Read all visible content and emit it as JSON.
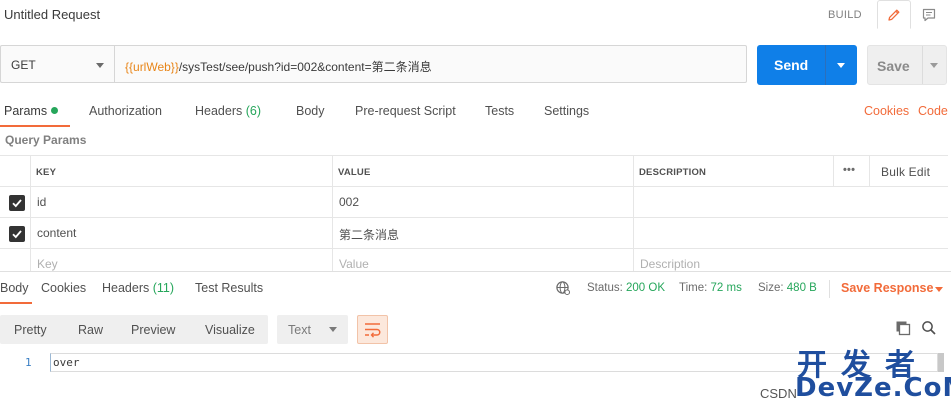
{
  "header": {
    "title": "Untitled Request",
    "build_label": "BUILD",
    "edit_icon": "pencil-icon",
    "comment_icon": "comment-icon"
  },
  "request": {
    "method": "GET",
    "url_variable": "{{urlWeb}}",
    "url_path": "/sysTest/see/push?id=002&content=第二条消息",
    "send_label": "Send",
    "save_label": "Save"
  },
  "request_tabs": {
    "params": "Params",
    "authorization": "Authorization",
    "headers": "Headers",
    "headers_count": "(6)",
    "body": "Body",
    "prerequest": "Pre-request Script",
    "tests": "Tests",
    "settings": "Settings",
    "cookies": "Cookies",
    "code": "Code"
  },
  "query_params": {
    "label": "Query Params",
    "columns": {
      "key": "KEY",
      "value": "VALUE",
      "description": "DESCRIPTION"
    },
    "more_label": "•••",
    "bulk_edit": "Bulk Edit",
    "rows": [
      {
        "key": "id",
        "value": "002",
        "description": "",
        "checked": true
      },
      {
        "key": "content",
        "value": "第二条消息",
        "description": "",
        "checked": true
      }
    ],
    "placeholder": {
      "key": "Key",
      "value": "Value",
      "description": "Description"
    }
  },
  "response_tabs": {
    "body": "Body",
    "cookies": "Cookies",
    "headers": "Headers",
    "headers_count": "(11)",
    "test_results": "Test Results"
  },
  "response_status": {
    "status_label": "Status:",
    "status_value": "200 OK",
    "time_label": "Time:",
    "time_value": "72 ms",
    "size_label": "Size:",
    "size_value": "480 B",
    "save_response": "Save Response"
  },
  "format_bar": {
    "pretty": "Pretty",
    "raw": "Raw",
    "preview": "Preview",
    "visualize": "Visualize",
    "text_select": "Text"
  },
  "response_body": {
    "line_number": "1",
    "content": "over"
  },
  "watermark": {
    "cn": "开发者",
    "en": "DevZe.CoM",
    "csdn": "CSDN"
  },
  "colors": {
    "accent": "#f26b3a",
    "send": "#0f7fe8",
    "success": "#26a65b",
    "variable": "#e8861a"
  }
}
